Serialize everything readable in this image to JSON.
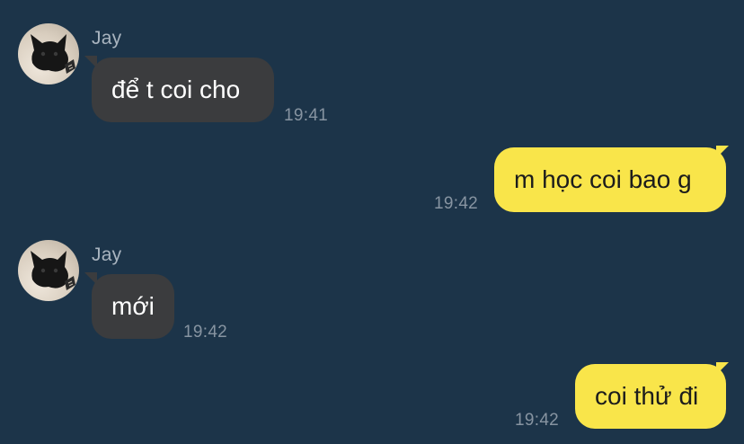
{
  "messages": [
    {
      "direction": "incoming",
      "sender": "Jay",
      "text": "để t coi cho",
      "time": "19:41",
      "avatar": "cat-avatar"
    },
    {
      "direction": "outgoing",
      "text": "m học coi bao g",
      "time": "19:42"
    },
    {
      "direction": "incoming",
      "sender": "Jay",
      "text": "mới",
      "time": "19:42",
      "avatar": "cat-avatar"
    },
    {
      "direction": "outgoing",
      "text": "coi thử đi",
      "time": "19:42"
    }
  ],
  "colors": {
    "background": "#1c3449",
    "incoming_bubble": "#3b3c3e",
    "outgoing_bubble": "#f9e54a",
    "timestamp": "#8794a1",
    "sender_name": "#a9b4bf"
  }
}
